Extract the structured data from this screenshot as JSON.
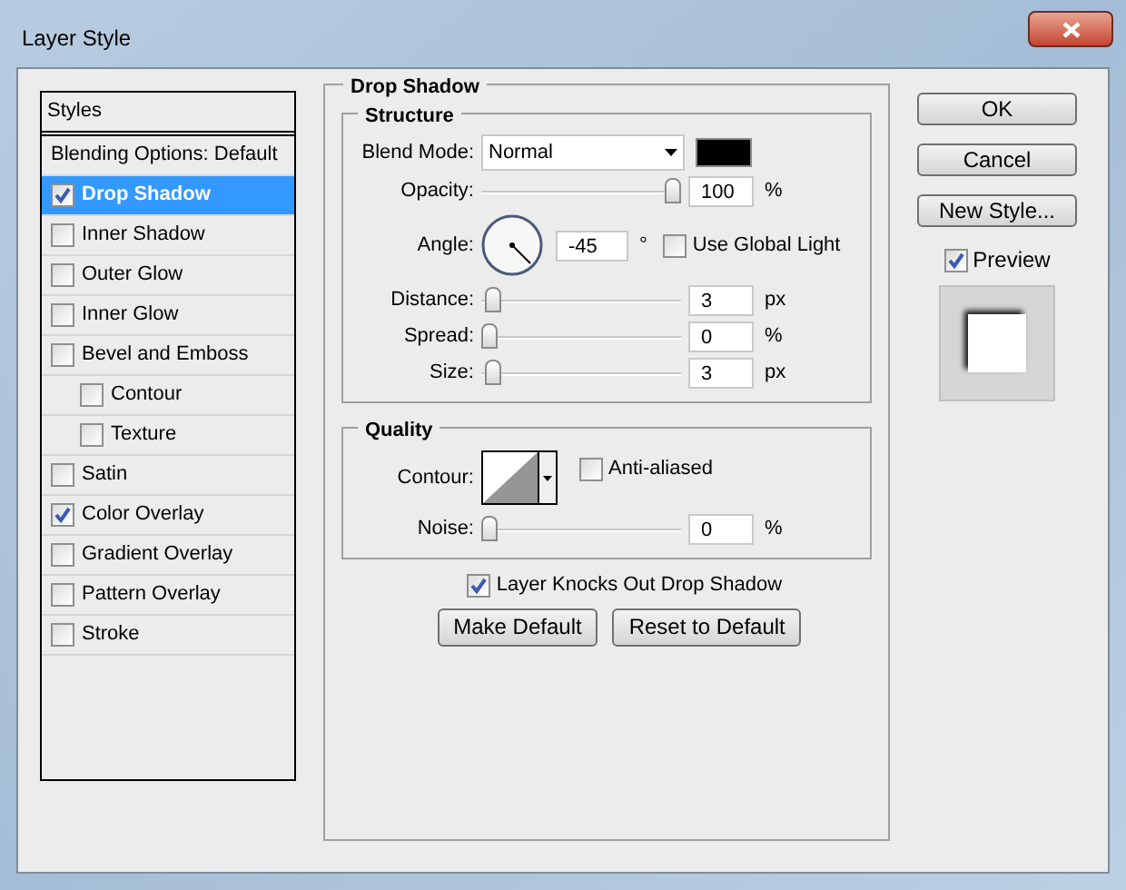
{
  "window": {
    "title": "Layer Style"
  },
  "styles_list": {
    "header": "Styles",
    "items": [
      {
        "label": "Blending Options: Default",
        "kind": "plain",
        "selected": false
      },
      {
        "label": "Drop Shadow",
        "kind": "check",
        "checked": true,
        "selected": true
      },
      {
        "label": "Inner Shadow",
        "kind": "check",
        "checked": false,
        "selected": false
      },
      {
        "label": "Outer Glow",
        "kind": "check",
        "checked": false,
        "selected": false
      },
      {
        "label": "Inner Glow",
        "kind": "check",
        "checked": false,
        "selected": false
      },
      {
        "label": "Bevel and Emboss",
        "kind": "check",
        "checked": false,
        "selected": false,
        "children": [
          {
            "label": "Contour",
            "kind": "check",
            "checked": false,
            "selected": false
          },
          {
            "label": "Texture",
            "kind": "check",
            "checked": false,
            "selected": false
          }
        ]
      },
      {
        "label": "Satin",
        "kind": "check",
        "checked": false,
        "selected": false
      },
      {
        "label": "Color Overlay",
        "kind": "check",
        "checked": true,
        "selected": false
      },
      {
        "label": "Gradient Overlay",
        "kind": "check",
        "checked": false,
        "selected": false
      },
      {
        "label": "Pattern Overlay",
        "kind": "check",
        "checked": false,
        "selected": false
      },
      {
        "label": "Stroke",
        "kind": "check",
        "checked": false,
        "selected": false
      }
    ]
  },
  "panel": {
    "title": "Drop Shadow",
    "structure": {
      "title": "Structure",
      "blend_mode": {
        "label": "Blend Mode:",
        "value": "Normal"
      },
      "opacity": {
        "label": "Opacity:",
        "level": 1,
        "value": "100",
        "unit": "%"
      },
      "angle": {
        "label": "Angle:",
        "value": "-45",
        "unit": "°"
      },
      "use_global_light": {
        "label": "Use Global Light",
        "checked": false
      },
      "distance": {
        "label": "Distance:",
        "level": 0.02,
        "value": "3",
        "unit": "px"
      },
      "spread": {
        "label": "Spread:",
        "level": 0,
        "value": "0",
        "unit": "%"
      },
      "size": {
        "label": "Size:",
        "level": 0.02,
        "value": "3",
        "unit": "px"
      }
    },
    "quality": {
      "title": "Quality",
      "contour": {
        "label": "Contour:"
      },
      "anti_aliased": {
        "label": "Anti-aliased",
        "checked": false
      },
      "noise": {
        "label": "Noise:",
        "level": 0,
        "value": "0",
        "unit": "%"
      }
    },
    "layer_knocks_out": {
      "label": "Layer Knocks Out Drop Shadow",
      "checked": true
    },
    "buttons": [
      "Make Default",
      "Reset to Default"
    ]
  },
  "actions": {
    "ok": "OK",
    "cancel": "Cancel",
    "new_style": "New Style...",
    "preview": {
      "label": "Preview",
      "checked": true
    }
  }
}
